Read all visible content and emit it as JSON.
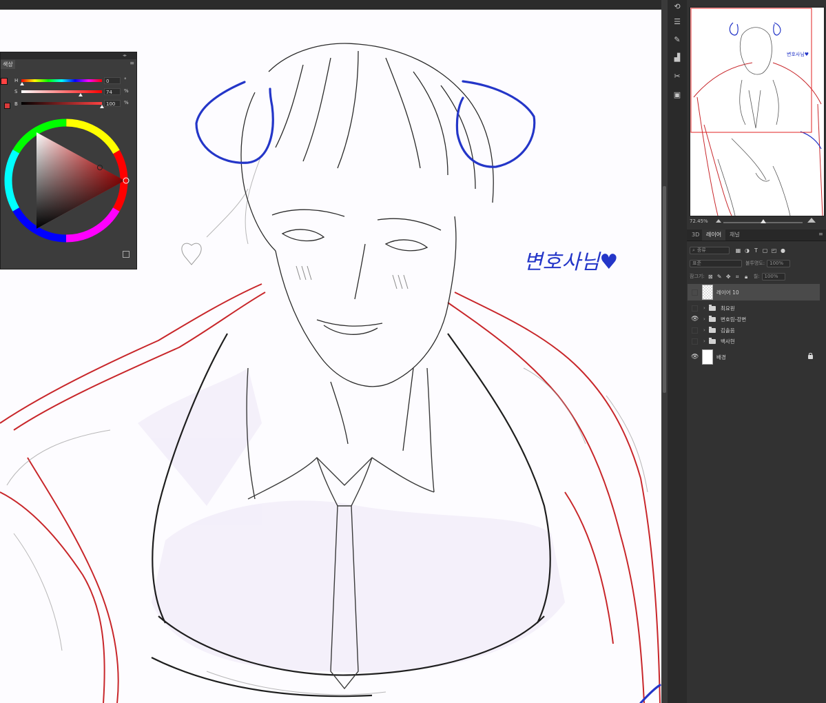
{
  "navigator": {
    "zoom": "72.45%"
  },
  "tabs": {
    "items": [
      "3D",
      "레이어",
      "채널"
    ]
  },
  "layers_toolbar": {
    "kind_filter": "종류",
    "blend_mode": "표준",
    "opacity_label": "불투명도:",
    "opacity_value": "100%",
    "lock_label": "잠그기:",
    "fill_label": "칠:",
    "fill_value": "100%"
  },
  "layers": [
    {
      "name": "레이어 10",
      "selected": true,
      "visible": false
    },
    {
      "name": "최요원",
      "type": "group",
      "visible": false
    },
    {
      "name": "변호림-강변",
      "type": "group",
      "visible": true
    },
    {
      "name": "김솔음",
      "type": "group",
      "visible": false
    },
    {
      "name": "백사현",
      "type": "group",
      "visible": false
    },
    {
      "name": "배경",
      "locked": true,
      "visible": true
    }
  ],
  "color_panel": {
    "tab_label": "색상",
    "h_label": "H",
    "h_value": "0",
    "h_unit": "°",
    "s_label": "S",
    "s_value": "74",
    "s_unit": "%",
    "b_label": "B",
    "b_value": "100",
    "b_unit": "%",
    "foreground_color": "#ff4242",
    "background_color": "#d93a3a"
  },
  "canvas": {
    "handwritten_text": "변호사님♥"
  },
  "colors": {
    "sketch_blue": "#2436c8",
    "sketch_red": "#c8262a",
    "sketch_gray": "#2a2a2a",
    "canvas_bg": "#fdfcff"
  }
}
